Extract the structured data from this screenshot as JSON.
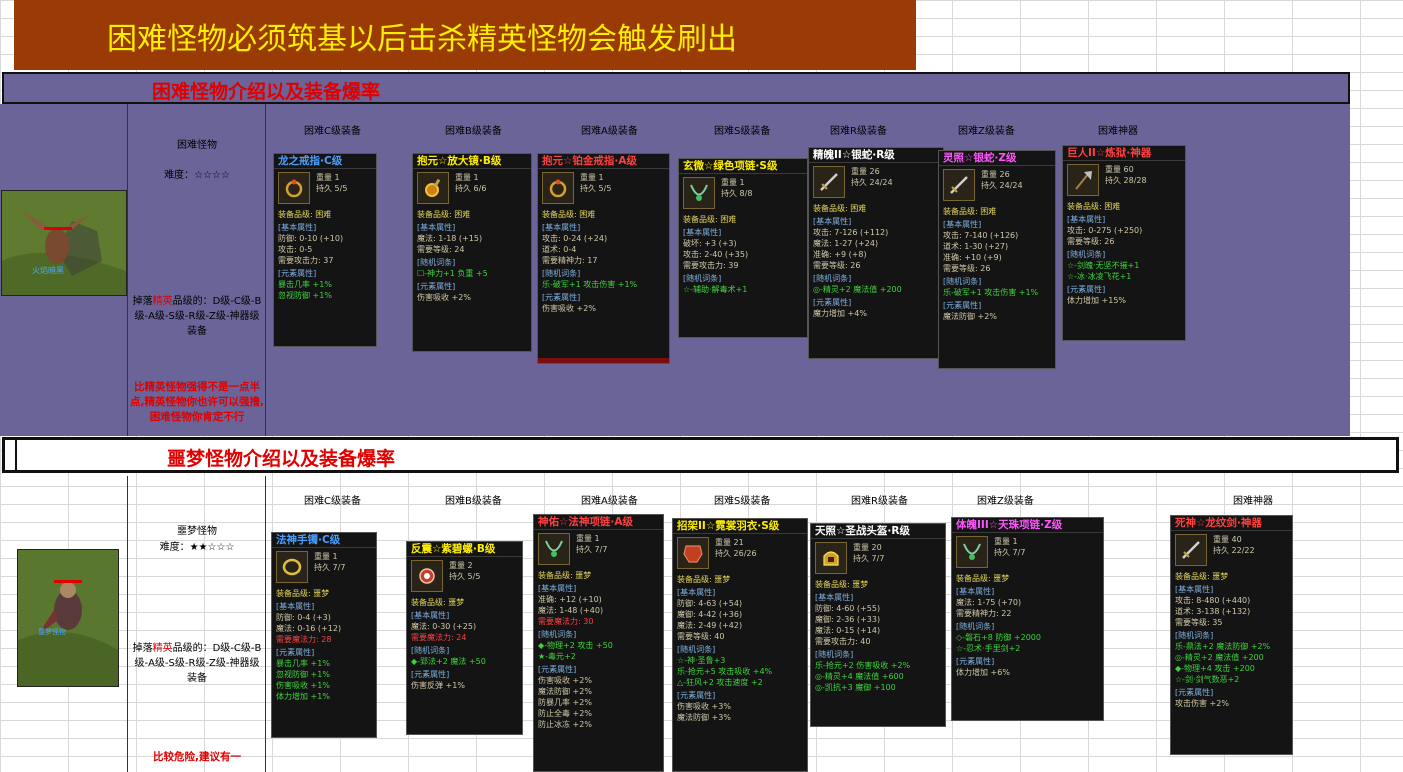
{
  "banner": {
    "title": "困难怪物必须筑基以后击杀精英怪物会触发刷出"
  },
  "section1": {
    "title": "困难怪物介绍以及装备爆率",
    "monster_name": "困难怪物",
    "difficulty_label": "难度：",
    "difficulty_stars": "☆☆☆☆",
    "drop_prefix": "掉落",
    "drop_highlight": "精英",
    "drop_suffix": "品级的：D级-C级-B级-A级-S级-R级-Z级-神器级装备",
    "warning": "比精英怪物强得不是一点半点,精英怪物你也许可以强撸,困难怪物你肯定不行",
    "columns": [
      "困难C级装备",
      "困难B级装备",
      "困难A级装备",
      "困难S级装备",
      "困难R级装备",
      "困难Z级装备",
      "困难神器"
    ]
  },
  "section2": {
    "title": "噩梦怪物介绍以及装备爆率",
    "monster_name": "噩梦怪物",
    "difficulty_label": "难度：",
    "difficulty_stars": "★★☆☆☆",
    "drop_prefix": "掉落",
    "drop_highlight": "精英",
    "drop_suffix": "品级的：D级-C级-B级-A级-S级-R级-Z级-神器级装备",
    "warning": "比较危险,建议有一",
    "columns": [
      "困难C级装备",
      "困难B级装备",
      "困难A级装备",
      "困难S级装备",
      "困难R级装备",
      "困难Z级装备",
      "困难神器"
    ]
  },
  "colors": {
    "banner_bg": "#9a3a05",
    "banner_text": "#ffee00",
    "panel_bg": "#6a6499",
    "title_red": "#e00000"
  },
  "cards1": [
    {
      "name": "龙之戒指·C级",
      "name_color": "#4aa0ff",
      "icon": "ring-icon",
      "stats": [
        "重量  1",
        "持久  5/5"
      ],
      "grade": "装备品级: 困难",
      "base_label": "[基本属性]",
      "base": [
        "防御:        0-10 (+10)",
        "攻击:        0-5",
        "需要攻击力: 37"
      ],
      "rand_label": "[元素属性]",
      "rand": [
        "暴击几率      +1%",
        "忽视防御      +1%"
      ],
      "elem_label": "",
      "elem": []
    },
    {
      "name": "抱元☆放大镜·B级",
      "name_color": "#ffee00",
      "icon": "magnifier-icon",
      "stats": [
        "重量  1",
        "持久  6/6"
      ],
      "grade": "装备品级: 困难",
      "base_label": "[基本属性]",
      "base": [
        "魔法:        1-18 (+15)",
        "需要等级:    24"
      ],
      "rand_label": "[随机词条]",
      "rand": [
        "☐-神力+1 负重 +5"
      ],
      "elem_label": "[元素属性]",
      "elem": [
        "伤害吸收       +2%"
      ]
    },
    {
      "name": "抱元☆铂金戒指·A级",
      "name_color": "#ff4040",
      "icon": "ring-icon",
      "stats": [
        "重量  1",
        "持久  5/5"
      ],
      "grade": "装备品级: 困难",
      "base_label": "[基本属性]",
      "base": [
        "攻击:        0-24 (+24)",
        "道术:        0-4",
        "需要精神力: 17"
      ],
      "rand_label": "[随机词条]",
      "rand": [
        "乐-破军+1  攻击伤害 +1%"
      ],
      "elem_label": "[元素属性]",
      "elem": [
        "伤害吸收       +2%"
      ]
    },
    {
      "name": "玄微☆绿色项链·S级",
      "name_color": "#ffee00",
      "icon": "necklace-icon",
      "stats": [
        "重量  1",
        "持久  8/8"
      ],
      "grade": "装备品级: 困难",
      "base_label": "[基本属性]",
      "base": [
        "破坏:        +3 (+3)",
        "攻击:        2-40 (+35)",
        "需要攻击力: 39"
      ],
      "rand_label": "[随机词条]",
      "rand": [
        "☆-辅助·解毒术+1"
      ],
      "elem_label": "",
      "elem": []
    },
    {
      "name": "精魄II☆银蛇·R级",
      "name_color": "#ffffff",
      "icon": "sword-icon",
      "stats": [
        "重量  26",
        "持久  24/24"
      ],
      "grade": "装备品级: 困难",
      "base_label": "[基本属性]",
      "base": [
        "攻击:        7-126 (+112)",
        "魔法:        1-27 (+24)",
        "准确:        +9 (+8)",
        "需要等级:    26"
      ],
      "rand_label": "[随机词条]",
      "rand": [
        "◎-精灵+2 魔法值 +200"
      ],
      "elem_label": "[元素属性]",
      "elem": [
        "魔力增加       +4%"
      ]
    },
    {
      "name": "灵照☆银蛇·Z级",
      "name_color": "#ff55ff",
      "icon": "sword-icon",
      "stats": [
        "重量  26",
        "持久  24/24"
      ],
      "grade": "装备品级: 困难",
      "base_label": "[基本属性]",
      "base": [
        "攻击:        7-140 (+126)",
        "道术:        1-30 (+27)",
        "准确:        +10 (+9)",
        "需要等级:    26"
      ],
      "rand_label": "[随机词条]",
      "rand": [
        "乐-破军+1  攻击伤害 +1%"
      ],
      "elem_label": "[元素属性]",
      "elem": [
        "魔法防御       +2%"
      ]
    },
    {
      "name": "巨人II☆炼狱·神器",
      "name_color": "#ff4040",
      "icon": "axe-icon",
      "stats": [
        "重量  60",
        "持久  28/28"
      ],
      "grade": "装备品级: 困难",
      "base_label": "[基本属性]",
      "base": [
        "攻击:        0-275 (+250)",
        "需要等级:    26"
      ],
      "rand_label": "[随机词条]",
      "rand": [
        "☆-剑魄·无坚不摧+1",
        "☆-冰·冰凌飞花+1"
      ],
      "elem_label": "[元素属性]",
      "elem": [
        "体力增加       +15%"
      ]
    }
  ],
  "cards2": [
    {
      "name": "法神手镯·C级",
      "name_color": "#4aa0ff",
      "icon": "bracelet-icon",
      "stats": [
        "重量  1",
        "持久  7/7"
      ],
      "grade": "装备品级: 噩梦",
      "base_label": "[基本属性]",
      "base": [
        "防御:        0-4 (+3)",
        "魔法:        0-16 (+12)",
        "需要魔法力: 28"
      ],
      "rand_label": "[元素属性]",
      "rand": [
        "暴击几率      +1%",
        "忽视防御      +1%",
        "伤害吸收      +1%",
        "体力增加      +1%"
      ],
      "elem_label": "",
      "elem": []
    },
    {
      "name": "反震☆紫碧螺·B级",
      "name_color": "#ffee00",
      "icon": "conch-icon",
      "stats": [
        "重量  2",
        "持久  5/5"
      ],
      "grade": "装备品级: 噩梦",
      "base_label": "[基本属性]",
      "base": [
        "魔法:        0-30 (+25)",
        "需要魔法力: 24"
      ],
      "rand_label": "[随机词条]",
      "rand": [
        "◆-郢法+2 魔法 +50"
      ],
      "elem_label": "[元素属性]",
      "elem": [
        "伤害反弹       +1%"
      ]
    },
    {
      "name": "神佑☆法神项链·A级",
      "name_color": "#ff4040",
      "icon": "necklace-icon",
      "stats": [
        "重量  1",
        "持久  7/7"
      ],
      "grade": "装备品级: 噩梦",
      "base_label": "[基本属性]",
      "base": [
        "准确:        +12 (+10)",
        "魔法:        1-48 (+40)",
        "需要魔法力: 30"
      ],
      "rand_label": "[随机词条]",
      "rand": [
        "◆-物理+2 攻击 +50",
        "★-毒元+2"
      ],
      "elem_label": "[元素属性]",
      "elem": [
        "伤害吸收       +2%",
        "魔法防御       +2%",
        "防暴几率       +2%",
        "防止全毒       +2%",
        "防止冰冻       +2%"
      ]
    },
    {
      "name": "招架II☆霓裳羽衣·S级",
      "name_color": "#ffee00",
      "icon": "armor-icon",
      "stats": [
        "重量  21",
        "持久  26/26"
      ],
      "grade": "装备品级: 噩梦",
      "base_label": "[基本属性]",
      "base": [
        "防御:        4-63 (+54)",
        "魔御:        4-42 (+36)",
        "魔法:        2-49 (+42)",
        "需要等级:    40"
      ],
      "rand_label": "[随机词条]",
      "rand": [
        "☆-神·圣鲁+3",
        "乐-抢元+5  攻击吸收 +4%",
        "△-狂风+2  攻击速度 +2"
      ],
      "elem_label": "[元素属性]",
      "elem": [
        "伤害吸收       +3%",
        "魔法防御       +3%"
      ]
    },
    {
      "name": "天照☆圣战头盔·R级",
      "name_color": "#ffffff",
      "icon": "helmet-icon",
      "stats": [
        "重量  20",
        "持久  7/7"
      ],
      "grade": "装备品级: 噩梦",
      "base_label": "[基本属性]",
      "base": [
        "防御:        4-60 (+55)",
        "魔御:        2-36 (+33)",
        "魔法:        0-15 (+14)",
        "需要攻击力: 40"
      ],
      "rand_label": "[随机词条]",
      "rand": [
        "乐-抢元+2  伤害吸收 +2%",
        "◎-精灵+4  魔法值 +600",
        "◎-凯抗+3  魔御 +100"
      ],
      "elem_label": "",
      "elem": []
    },
    {
      "name": "体魄III☆天珠项链·Z级",
      "name_color": "#ff55ff",
      "icon": "necklace-icon",
      "stats": [
        "重量  1",
        "持久  7/7"
      ],
      "grade": "装备品级: 噩梦",
      "base_label": "[基本属性]",
      "base": [
        "魔法:        1-75 (+70)",
        "需要精神力: 22"
      ],
      "rand_label": "[随机词条]",
      "rand": [
        "◇-磐石+8 防御 +2000",
        "☆-忍术·手里剑+2"
      ],
      "elem_label": "[元素属性]",
      "elem": [
        "体力增加       +6%"
      ]
    },
    {
      "name": "死神☆龙纹剑·神器",
      "name_color": "#ff4040",
      "icon": "sword-icon",
      "stats": [
        "重量  40",
        "持久  22/22"
      ],
      "grade": "装备品级: 噩梦",
      "base_label": "[基本属性]",
      "base": [
        "攻击:        8-480 (+440)",
        "道术:        3-138 (+132)",
        "需要等级:    35"
      ],
      "rand_label": "[随机词条]",
      "rand": [
        "乐-鼎法+2  魔法防御 +2%",
        "◎-精灵+2  魔法值 +200",
        "◆-物理+4  攻击 +200",
        "☆-剑·剑气数恶+2"
      ],
      "elem_label": "[元素属性]",
      "elem": [
        "攻击伤害       +2%"
      ]
    }
  ]
}
